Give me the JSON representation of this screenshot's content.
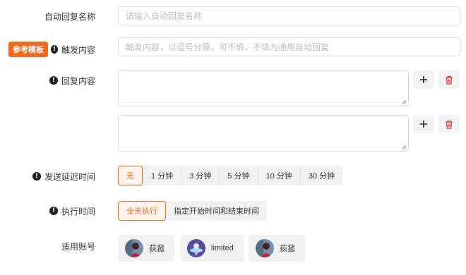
{
  "form": {
    "name_label": "自动回复名称",
    "name_placeholder": "请输入自动回复名称",
    "ref_button": "参考模板",
    "trigger_label": "触发内容",
    "trigger_placeholder": "触发内容，以逗号分隔，可不填，不填为通用自动回复",
    "reply_label": "回复内容",
    "delay_label": "发送延迟时间",
    "delay_options": [
      "无",
      "1 分钟",
      "3 分钟",
      "5 分钟",
      "10 分钟",
      "30 分钟"
    ],
    "delay_selected": "无",
    "time_label": "执行时间",
    "time_options": [
      "全天执行",
      "指定开始时间和结束时间"
    ],
    "time_selected": "全天执行",
    "accounts_label": "适用账号",
    "accounts": [
      "荻菰",
      "limited",
      "荻菰"
    ]
  },
  "colors": {
    "accent": "#f46a1d",
    "danger": "#e53935"
  },
  "icons": {
    "warn": "warning-icon",
    "add": "plus-icon",
    "delete": "trash-icon"
  }
}
